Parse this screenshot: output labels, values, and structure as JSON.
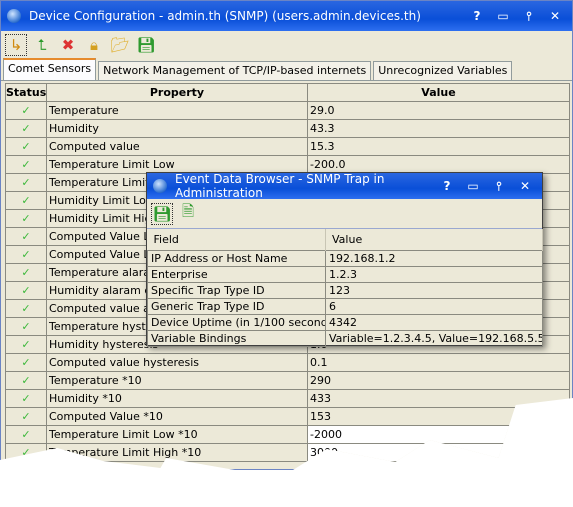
{
  "window": {
    "title": "Device Configuration - admin.th (SNMP) (users.admin.devices.th)",
    "help": "?",
    "close": "✕"
  },
  "toolbar": [
    "arrow-down-icon",
    "arrow-up-icon",
    "delete-icon",
    "lock-icon",
    "open-folder-icon",
    "save-icon"
  ],
  "tabs": [
    "Comet Sensors",
    "Network Management of TCP/IP-based internets",
    "Unrecognized Variables"
  ],
  "table": {
    "headers": [
      "Status",
      "Property",
      "Value"
    ],
    "rows": [
      {
        "property": "Temperature",
        "value": "29.0"
      },
      {
        "property": "Humidity",
        "value": "43.3"
      },
      {
        "property": "Computed value",
        "value": "15.3"
      },
      {
        "property": "Temperature Limit Low",
        "value": "-200.0"
      },
      {
        "property": "Temperature Limit High",
        "value": ""
      },
      {
        "property": "Humidity Limit Low",
        "value": ""
      },
      {
        "property": "Humidity Limit High",
        "value": ""
      },
      {
        "property": "Computed Value Limit Low",
        "value": ""
      },
      {
        "property": "Computed Value Limit High",
        "value": ""
      },
      {
        "property": "Temperature alaram delay",
        "value": ""
      },
      {
        "property": "Humidity alaram delay",
        "value": ""
      },
      {
        "property": "Computed value alarm delay",
        "value": ""
      },
      {
        "property": "Temperature hysteresis",
        "value": ""
      },
      {
        "property": "Humidity hysteresis",
        "value": "1.0"
      },
      {
        "property": "Computed value hysteresis",
        "value": "0.1"
      },
      {
        "property": "Temperature *10",
        "value": "290"
      },
      {
        "property": "Humidity *10",
        "value": "433"
      },
      {
        "property": "Computed Value *10",
        "value": "153"
      },
      {
        "property": "Temperature Limit Low *10",
        "value": "-2000"
      },
      {
        "property": "Temperature Limit High *10",
        "value": "3000"
      }
    ]
  },
  "popup": {
    "title": "Event Data Browser - SNMP Trap in Administration",
    "help": "?",
    "close": "✕",
    "toolbar": [
      "save-icon",
      "validate-document-icon"
    ],
    "headers": [
      "Field",
      "Value"
    ],
    "rows": [
      {
        "field": "IP Address or Host Name",
        "value": "192.168.1.2"
      },
      {
        "field": "Enterprise",
        "value": "1.2.3"
      },
      {
        "field": "Specific Trap Type ID",
        "value": "123"
      },
      {
        "field": "Generic Trap Type ID",
        "value": "6"
      },
      {
        "field": "Device Uptime (in 1/100 seconds)",
        "value": "4342"
      },
      {
        "field": "Variable Bindings",
        "value": "Variable=1.2.3.4.5, Value=192.168.5.5"
      }
    ]
  }
}
